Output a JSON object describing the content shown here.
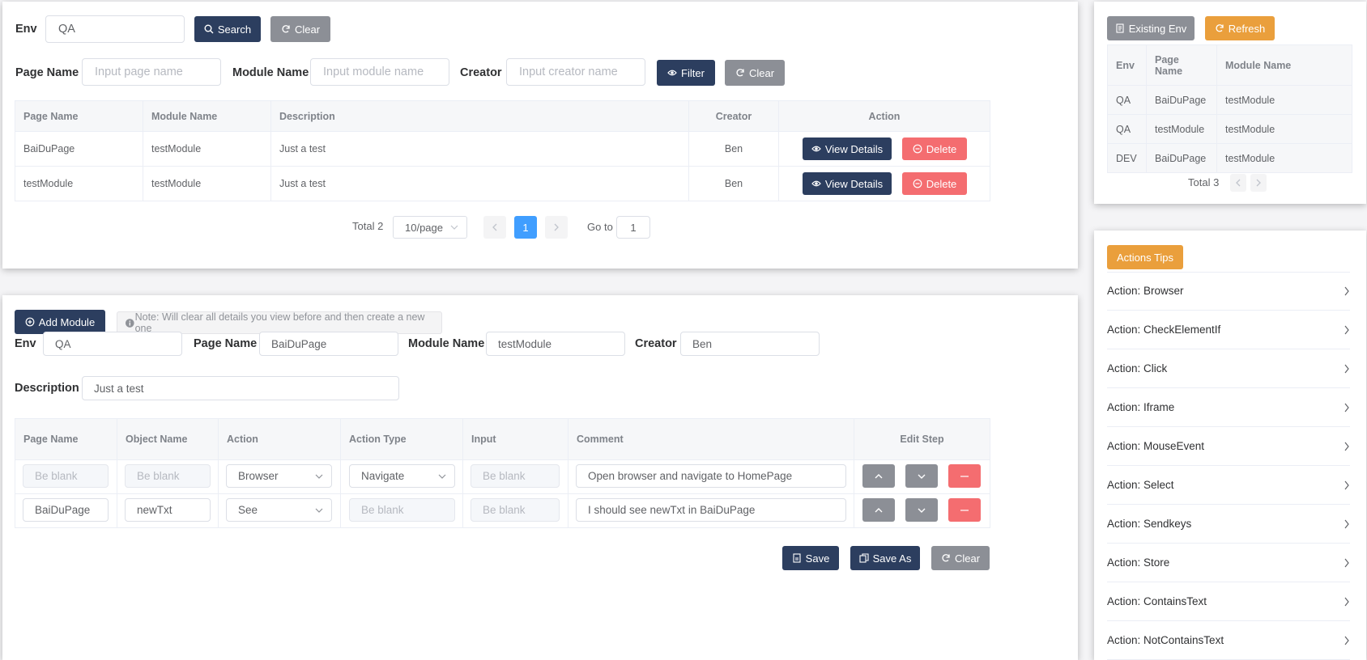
{
  "search_panel": {
    "env_label": "Env",
    "env_value": "QA",
    "search_label": "Search",
    "clear_label": "Clear",
    "page_name_label": "Page Name",
    "page_name_placeholder": "Input page name",
    "module_name_label": "Module Name",
    "module_name_placeholder": "Input module name",
    "creator_label": "Creator",
    "creator_placeholder": "Input creator name",
    "filter_label": "Filter",
    "clear2_label": "Clear",
    "table": {
      "headers": [
        "Page Name",
        "Module Name",
        "Description",
        "Creator",
        "Action"
      ],
      "rows": [
        {
          "page": "BaiDuPage",
          "module": "testModule",
          "desc": "Just a test",
          "creator": "Ben"
        },
        {
          "page": "testModule",
          "module": "testModule",
          "desc": "Just a test",
          "creator": "Ben"
        }
      ],
      "view_label": "View Details",
      "delete_label": "Delete"
    },
    "pagination": {
      "total": "Total 2",
      "page_size": "10/page",
      "current_page": "1",
      "goto_label": "Go to",
      "goto_value": "1"
    }
  },
  "env_panel": {
    "existing_env_label": "Existing Env",
    "refresh_label": "Refresh",
    "headers": [
      "Env",
      "Page Name",
      "Module Name"
    ],
    "rows": [
      {
        "env": "QA",
        "page": "BaiDuPage",
        "module": "testModule"
      },
      {
        "env": "QA",
        "page": "testModule",
        "module": "testModule"
      },
      {
        "env": "DEV",
        "page": "BaiDuPage",
        "module": "testModule"
      }
    ],
    "total": "Total 3"
  },
  "edit_panel": {
    "add_module_label": "Add Module",
    "note": "Note: Will clear all details you view before and then create a new one",
    "env_label": "Env",
    "env_value": "QA",
    "page_name_label": "Page Name",
    "page_name_value": "BaiDuPage",
    "module_name_label": "Module Name",
    "module_name_value": "testModule",
    "creator_label": "Creator",
    "creator_value": "Ben",
    "description_label": "Description",
    "description_value": "Just a test",
    "steps": {
      "headers": [
        "Page Name",
        "Object Name",
        "Action",
        "Action Type",
        "Input",
        "Comment",
        "Edit Step"
      ],
      "placeholder": "Be blank",
      "rows": [
        {
          "page": "",
          "object": "",
          "action": "Browser",
          "action_type": "Navigate",
          "input": "",
          "comment": "Open browser and navigate to HomePage"
        },
        {
          "page": "BaiDuPage",
          "object": "newTxt",
          "action": "See",
          "action_type": "",
          "input": "",
          "comment": "I should see newTxt in BaiDuPage"
        }
      ]
    },
    "save_label": "Save",
    "save_as_label": "Save As",
    "clear_label": "Clear"
  },
  "tips_panel": {
    "title": "Actions Tips",
    "items": [
      "Action: Browser",
      "Action: CheckElementIf",
      "Action: Click",
      "Action: Iframe",
      "Action: MouseEvent",
      "Action: Select",
      "Action: Sendkeys",
      "Action: Store",
      "Action: ContainsText",
      "Action: NotContainsText"
    ]
  }
}
